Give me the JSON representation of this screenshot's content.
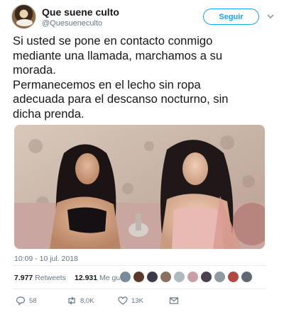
{
  "account": {
    "display_name": "Que suene culto",
    "handle": "@Quesueneculto",
    "avatar_icon": "portrait-avatar-icon"
  },
  "follow_label": "Seguir",
  "tweet_text": "Si usted se pone en contacto conmigo\nmediante una llamada, marchamos a su\nmorada.\nPermanecemos en el lecho sin ropa\nadecuada para el descanso nocturno, sin\ndicha prenda.",
  "timestamp": "10:09 - 10 jul. 2018",
  "stats": {
    "retweets_count": "7.977",
    "retweets_label": "Retweets",
    "likes_count": "12.931",
    "likes_label": "Me gusta"
  },
  "liker_colors": [
    "#7a8a9a",
    "#5a3a2a",
    "#3a3a4a",
    "#8a7060",
    "#b0b8c0",
    "#c8a0a8",
    "#4a4050",
    "#909aa0",
    "#b04a40",
    "#606870"
  ],
  "actions": [
    {
      "icon": "reply-icon",
      "count": "58"
    },
    {
      "icon": "retweet-icon",
      "count": "8,0K"
    },
    {
      "icon": "heart-icon",
      "count": "13K"
    },
    {
      "icon": "direct-message-icon",
      "count": ""
    }
  ],
  "colors": {
    "accent": "#1da1f2",
    "text": "#14171a",
    "secondary_text": "#657786"
  }
}
